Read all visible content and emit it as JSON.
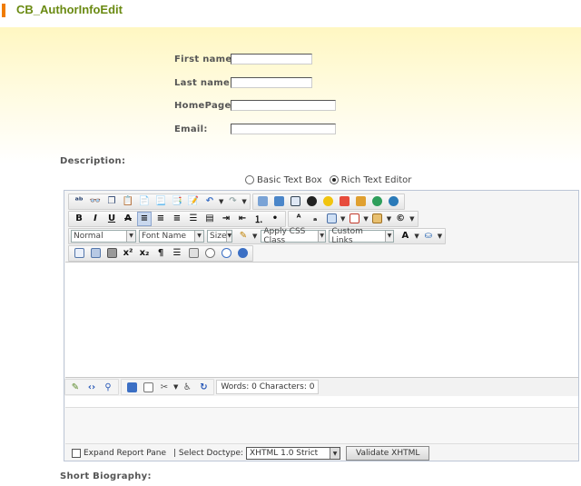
{
  "page": {
    "title": "CB_AuthorInfoEdit"
  },
  "form": {
    "first_name": {
      "label": "First name:",
      "value": ""
    },
    "last_name": {
      "label": "Last name:",
      "value": ""
    },
    "homepage": {
      "label": "HomePage:",
      "value": ""
    },
    "email": {
      "label": "Email:",
      "value": ""
    }
  },
  "description": {
    "label": "Description:",
    "mode_basic": "Basic Text Box",
    "mode_rich": "Rich Text Editor",
    "selected_mode": "Rich Text Editor"
  },
  "editor": {
    "paragraph_style": "Normal",
    "font_name": "Font Name",
    "font_size": "Size",
    "css_class": "Apply CSS Class",
    "custom_links": "Custom Links",
    "word_count": "Words: 0 Characters: 0",
    "expand_report": "Expand Report Pane",
    "doctype_label": "| Select Doctype:",
    "doctype_value": "XHTML 1.0 Strict",
    "validate_label": "Validate XHTML"
  },
  "short_bio": {
    "label": "Short Biography:"
  },
  "colors": {
    "title_green": "#6a8a12",
    "accent_orange": "#f07c00",
    "panel_yellow": "#fff7c2"
  }
}
